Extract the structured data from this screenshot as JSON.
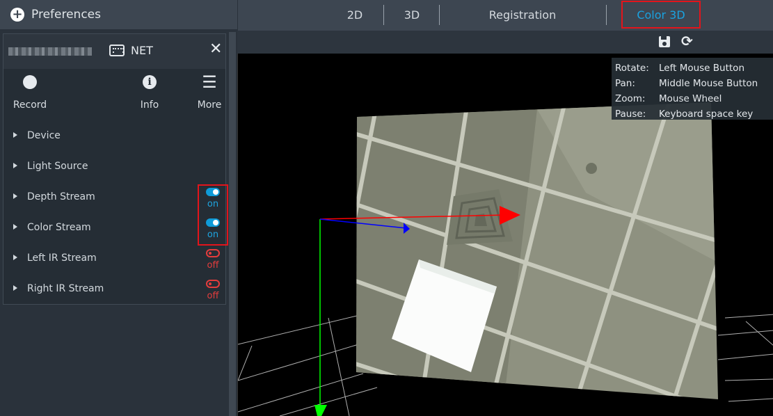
{
  "preferences": {
    "label": "Preferences",
    "icon": "plus-circle-icon"
  },
  "device": {
    "connection_label": "NET",
    "connection_icon": "ethernet-icon",
    "close_icon": "close-icon",
    "tools": [
      {
        "label": "Record",
        "icon": "record-icon"
      },
      {
        "label": "Info",
        "icon": "info-icon"
      },
      {
        "label": "More",
        "icon": "menu-icon"
      }
    ],
    "sections": [
      {
        "label": "Device"
      },
      {
        "label": "Light Source"
      },
      {
        "label": "Depth Stream",
        "toggle": "on"
      },
      {
        "label": "Color Stream",
        "toggle": "on"
      },
      {
        "label": "Left IR Stream",
        "toggle": "off"
      },
      {
        "label": "Right IR Stream",
        "toggle": "off"
      }
    ]
  },
  "tabs": [
    {
      "label": "2D"
    },
    {
      "label": "3D"
    },
    {
      "label": "Registration"
    },
    {
      "label": "Color 3D",
      "active": true
    }
  ],
  "toolbar": {
    "save_icon": "save-icon",
    "refresh_icon": "refresh-icon"
  },
  "help": [
    {
      "key": "Rotate:",
      "value": "Left Mouse Button"
    },
    {
      "key": "Pan:",
      "value": "Middle Mouse Button"
    },
    {
      "key": "Zoom:",
      "value": "Mouse Wheel"
    },
    {
      "key": "Pause:",
      "value": "Keyboard space key"
    }
  ],
  "colors": {
    "accent": "#1aa2e0",
    "toggle_on": "#0f9bd8",
    "toggle_off": "#e53c3c",
    "highlight": "#e3141b",
    "axis_x": "#ff0000",
    "axis_y": "#00ff00",
    "axis_z": "#0000ff"
  }
}
